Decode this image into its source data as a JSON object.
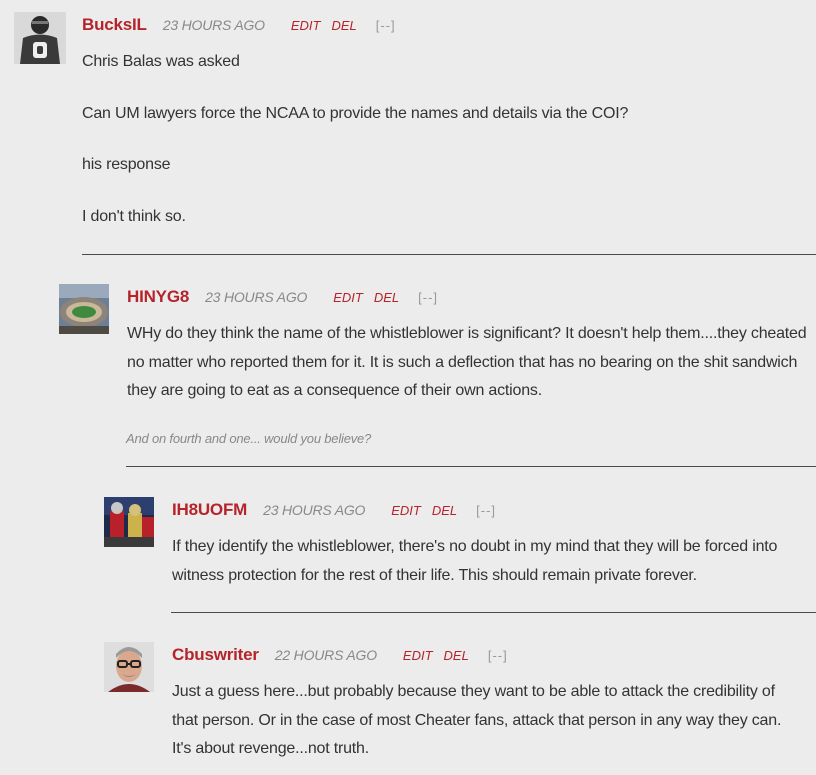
{
  "comments": [
    {
      "username": "BucksIL",
      "time": "23 HOURS AGO",
      "edit_label": "EDIT",
      "del_label": "DEL",
      "collapse_label": "[--]",
      "avatar_icon": "football-jersey-avatar",
      "paragraphs": [
        "Chris Balas was asked",
        "Can UM lawyers force the NCAA to provide the names and details via the COI?",
        "his response",
        "I don't think so."
      ]
    },
    {
      "username": "HINYG8",
      "time": "23 HOURS AGO",
      "edit_label": "EDIT",
      "del_label": "DEL",
      "collapse_label": "[--]",
      "avatar_icon": "stadium-avatar",
      "paragraphs": [
        "WHy do they think the name of the whistleblower is significant? It doesn't help them....they cheated no matter who reported them for it. It is such a deflection that has no bearing on the shit sandwich they are going to eat as a consequence of their own actions."
      ],
      "signature": "And on fourth and one... would you believe?"
    },
    {
      "username": "IH8UOFM",
      "time": "23 HOURS AGO",
      "edit_label": "EDIT",
      "del_label": "DEL",
      "collapse_label": "[--]",
      "avatar_icon": "football-game-avatar",
      "paragraphs": [
        "If they identify the whistleblower, there's no doubt in my mind that they will be forced into witness protection for the rest of their life. This should remain private forever."
      ]
    },
    {
      "username": "Cbuswriter",
      "time": "22 HOURS AGO",
      "edit_label": "EDIT",
      "del_label": "DEL",
      "collapse_label": "[--]",
      "avatar_icon": "man-with-glasses-avatar",
      "paragraphs": [
        "Just a guess here...but probably because they want to be able to attack the credibility of that person. Or in the case of most Cheater fans, attack that person in any way they can. It's about revenge...not truth."
      ]
    }
  ]
}
